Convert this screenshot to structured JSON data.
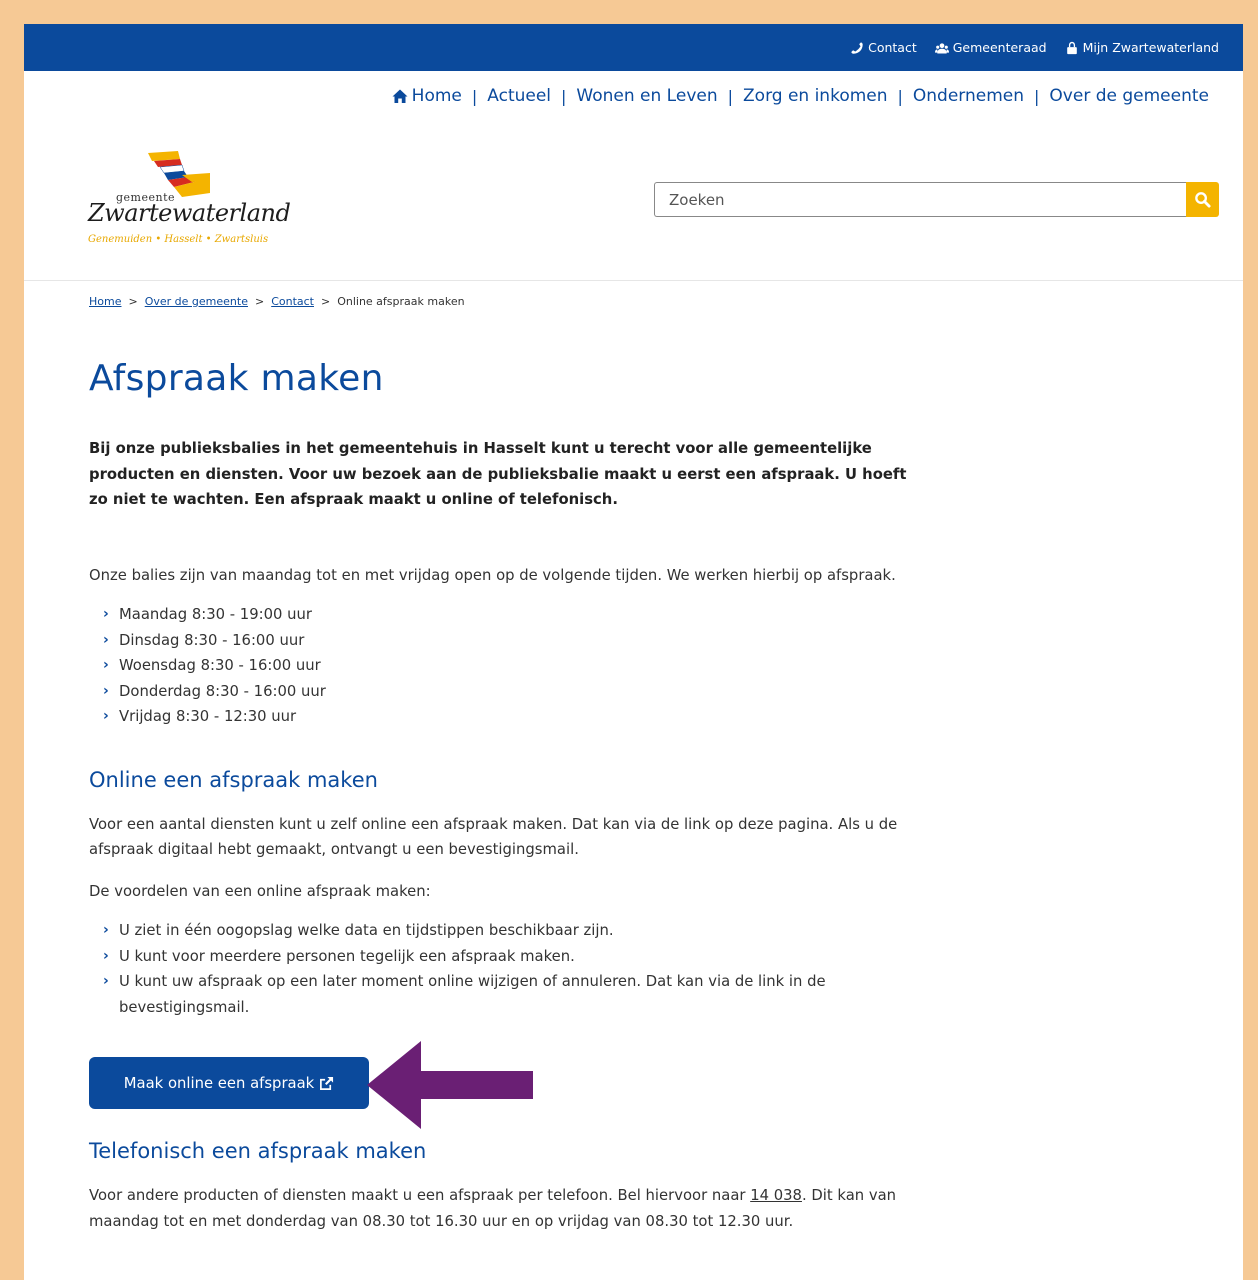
{
  "topbar": {
    "contact": "Contact",
    "council": "Gemeenteraad",
    "my_account": "Mijn Zwartewaterland"
  },
  "nav": {
    "items": [
      "Home",
      "Actueel",
      "Wonen en Leven",
      "Zorg en inkomen",
      "Ondernemen",
      "Over de gemeente"
    ],
    "separator": "|"
  },
  "logo": {
    "small": "gemeente",
    "name": "Zwartewaterland",
    "tagline": "Genemuiden • Hasselt • Zwartsluis"
  },
  "search": {
    "placeholder": "Zoeken"
  },
  "breadcrumb": {
    "items": [
      "Home",
      "Over de gemeente",
      "Contact"
    ],
    "current": "Online afspraak maken",
    "separator": ">"
  },
  "page": {
    "title": "Afspraak maken",
    "intro": "Bij onze publieksbalies in het gemeentehuis in Hasselt kunt u terecht voor alle gemeentelijke producten en diensten. Voor uw bezoek aan de publieksbalie maakt u eerst een afspraak. U hoeft zo niet te wachten. Een afspraak maakt u online of telefonisch.",
    "hours_intro": "Onze balies zijn van maandag tot en met vrijdag open op de volgende tijden. We werken hierbij op afspraak.",
    "hours": [
      "Maandag 8:30 - 19:00 uur",
      "Dinsdag 8:30 - 16:00 uur",
      "Woensdag 8:30 - 16:00 uur",
      "Donderdag 8:30 - 16:00 uur",
      "Vrijdag 8:30 - 12:30 uur"
    ]
  },
  "online": {
    "heading": "Online een afspraak maken",
    "p1": "Voor een aantal diensten kunt u zelf online een afspraak maken. Dat kan via de link op deze pagina. Als u de afspraak digitaal hebt gemaakt, ontvangt u een bevestigingsmail.",
    "p2": "De voordelen van een online afspraak maken:",
    "benefits": [
      "U ziet in één oogopslag welke data en tijdstippen beschikbaar zijn.",
      "U kunt voor meerdere personen tegelijk een afspraak maken.",
      "U kunt uw afspraak op een later moment online wijzigen of annuleren. Dat kan via de link in de bevestigingsmail."
    ],
    "button": "Maak online een afspraak"
  },
  "phone": {
    "heading": "Telefonisch een afspraak maken",
    "text_before": "Voor andere producten of diensten maakt u een afspraak per telefoon. Bel hiervoor naar ",
    "number": "14 038",
    "text_after": ". Dit kan van maandag tot en met donderdag van 08.30 tot 16.30 uur en op vrijdag van 08.30 tot 12.30 uur."
  },
  "colors": {
    "brand_blue": "#0b4a9c",
    "search_button": "#f4b400",
    "background_frame": "#f6c995",
    "annotation_arrow": "#6a1f74"
  },
  "icons": {
    "contact": "phone-icon",
    "council": "people-icon",
    "my_account": "lock-icon",
    "home": "home-icon",
    "search": "search-icon",
    "list_marker": "chevron-right-icon",
    "external": "external-link-icon",
    "annotation": "arrow-left-icon"
  }
}
